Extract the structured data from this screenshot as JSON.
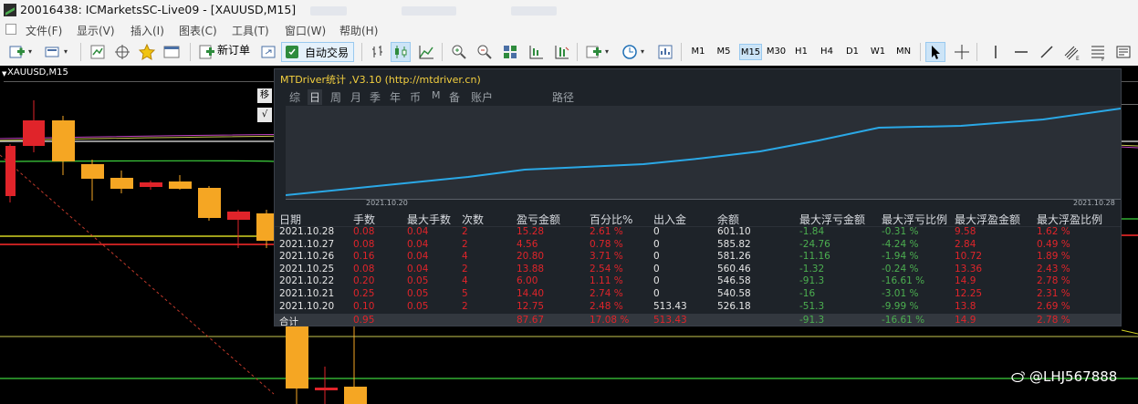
{
  "window": {
    "title": "20016438: ICMarketsSC-Live09 - [XAUUSD,M15]"
  },
  "menu": [
    "文件(F)",
    "显示(V)",
    "插入(I)",
    "图表(C)",
    "工具(T)",
    "窗口(W)",
    "帮助(H)"
  ],
  "toolbar": {
    "new_order": "新订单",
    "auto_trading": "自动交易",
    "timeframes": [
      "M1",
      "M5",
      "M15",
      "M30",
      "H1",
      "H4",
      "D1",
      "W1",
      "MN"
    ],
    "active_timeframe": "M15"
  },
  "chart": {
    "symbol_tab": "XAUUSD,M15",
    "side_chip": "移",
    "side_chip2": "√",
    "colors": {
      "bull": "#f5a623",
      "bear": "#e0242a",
      "background": "#000000"
    }
  },
  "panel": {
    "title": "MTDriver统计 ,V3.10 (http://mtdriver.cn)",
    "tabs": [
      "综",
      "日",
      "周",
      "月",
      "季",
      "年",
      "币",
      "M",
      "备",
      "账户"
    ],
    "active_tab": "日",
    "path_tab": "路径",
    "graph": {
      "start_label": "2021.10.20",
      "end_label": "2021.10.28",
      "line_color": "#2aa8e6"
    },
    "headers": [
      "日期",
      "手数",
      "最大手数",
      "次数",
      "盈亏金额",
      "百分比%",
      "出入金",
      "余额",
      "最大浮亏金额",
      "最大浮亏比例",
      "最大浮盈金额",
      "最大浮盈比例"
    ],
    "rows": [
      [
        "2021.10.28",
        "0.08",
        "0.04",
        "2",
        "15.28",
        "2.61 %",
        "0",
        "601.10",
        "-1.84",
        "-0.31 %",
        "9.58",
        "1.62 %"
      ],
      [
        "2021.10.27",
        "0.08",
        "0.04",
        "2",
        "4.56",
        "0.78 %",
        "0",
        "585.82",
        "-24.76",
        "-4.24 %",
        "2.84",
        "0.49 %"
      ],
      [
        "2021.10.26",
        "0.16",
        "0.04",
        "4",
        "20.80",
        "3.71 %",
        "0",
        "581.26",
        "-11.16",
        "-1.94 %",
        "10.72",
        "1.89 %"
      ],
      [
        "2021.10.25",
        "0.08",
        "0.04",
        "2",
        "13.88",
        "2.54 %",
        "0",
        "560.46",
        "-1.32",
        "-0.24 %",
        "13.36",
        "2.43 %"
      ],
      [
        "2021.10.22",
        "0.20",
        "0.05",
        "4",
        "6.00",
        "1.11 %",
        "0",
        "546.58",
        "-91.3",
        "-16.61 %",
        "14.9",
        "2.78 %"
      ],
      [
        "2021.10.21",
        "0.25",
        "0.05",
        "5",
        "14.40",
        "2.74 %",
        "0",
        "540.58",
        "-16",
        "-3.01 %",
        "12.25",
        "2.31 %"
      ],
      [
        "2021.10.20",
        "0.10",
        "0.05",
        "2",
        "12.75",
        "2.48 %",
        "513.43",
        "526.18",
        "-51.3",
        "-9.99 %",
        "13.8",
        "2.69 %"
      ]
    ],
    "total": [
      "合计",
      "0.95",
      "",
      "",
      "87.67",
      "17.08 %",
      "513.43",
      "",
      "-91.3",
      "-16.61 %",
      "14.9",
      "2.78 %"
    ]
  },
  "watermark": "@LHJ567888"
}
